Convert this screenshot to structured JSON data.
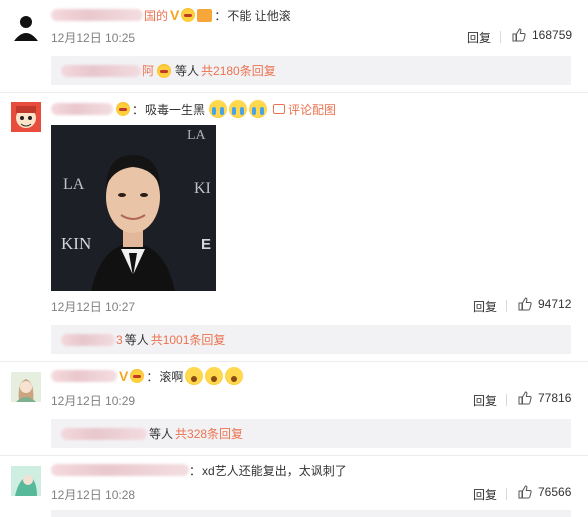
{
  "comments": [
    {
      "name_suffix": "国的",
      "has_v": true,
      "v_glyph": "V",
      "vip_label": "",
      "text": "不能 让他滚",
      "time": "12月12日 10:25",
      "reply": "回复",
      "likes": "168759",
      "replies": {
        "equal": "等人",
        "total": "共2180条回复",
        "name_suffix": "阿"
      }
    },
    {
      "name_suffix": "",
      "text": "吸毒一生黑",
      "link": "评论配图",
      "time": "12月12日 10:27",
      "reply": "回复",
      "likes": "94712",
      "replies": {
        "equal": "等人",
        "total": "共1001条回复",
        "name_suffix": "3"
      },
      "photo_text": {
        "kin_left": "KIN",
        "kin_right": "KI",
        "la_top": "LA",
        "la_right": "LA",
        "la_left": "LA",
        "e_right": "E"
      }
    },
    {
      "has_v": true,
      "v_glyph": "V",
      "text": "滚啊",
      "time": "12月12日 10:29",
      "reply": "回复",
      "likes": "77816",
      "replies": {
        "equal": "等人",
        "total": "共328条回复"
      }
    },
    {
      "text": "xd艺人还能复出，太讽刺了",
      "time": "12月12日 10:28",
      "reply": "回复",
      "likes": "76566"
    }
  ],
  "colors": {
    "accent": "#eb7350",
    "muted": "#808080",
    "subbox": "#f2f2f5"
  }
}
